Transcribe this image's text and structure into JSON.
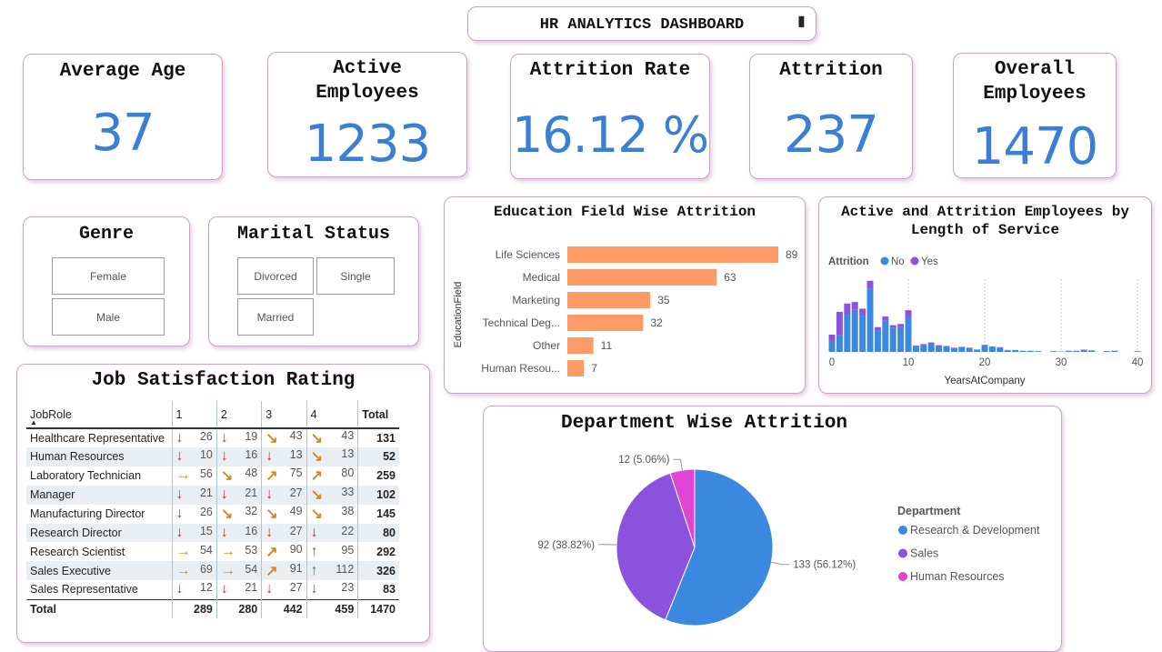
{
  "header": {
    "title": "HR ANALYTICS DASHBOARD",
    "marker": "▮"
  },
  "kpis": {
    "average_age": {
      "title": "Average Age",
      "value": "37"
    },
    "active_employees": {
      "title_line1": "Active",
      "title_line2": "Employees",
      "value": "1233"
    },
    "attrition_rate": {
      "title": "Attrition Rate",
      "value": "16.12 %"
    },
    "attrition": {
      "title": "Attrition",
      "value": "237"
    },
    "overall_employees": {
      "title_line1": "Overall",
      "title_line2": "Employees",
      "value": "1470"
    }
  },
  "slicers": {
    "genre": {
      "title": "Genre",
      "options": [
        "Female",
        "Male"
      ]
    },
    "marital": {
      "title": "Marital Status",
      "options": [
        "Divorced",
        "Single",
        "Married"
      ]
    }
  },
  "colors": {
    "accent_blue": "#3a7fd6",
    "bar_orange": "#fd9b67",
    "pie_blue": "#3a88e0",
    "pie_purple": "#8a52dd",
    "pie_magenta": "#e044d4",
    "arrow_red": "#c0392b",
    "arrow_orange": "#d08a21",
    "arrow_green": "#2e8b57"
  },
  "job_satisfaction": {
    "title": "Job Satisfaction Rating",
    "columns": [
      "JobRole",
      "1",
      "2",
      "3",
      "4",
      "Total"
    ],
    "rows": [
      {
        "role": "Healthcare Representative",
        "v": [
          26,
          19,
          43,
          43
        ],
        "a": [
          "down",
          "down",
          "downright",
          "downright"
        ],
        "total": 131
      },
      {
        "role": "Human Resources",
        "v": [
          10,
          16,
          13,
          13
        ],
        "a": [
          "down",
          "down",
          "down",
          "downright"
        ],
        "total": 52
      },
      {
        "role": "Laboratory Technician",
        "v": [
          56,
          48,
          75,
          80
        ],
        "a": [
          "right",
          "downright",
          "upright",
          "upright"
        ],
        "total": 259
      },
      {
        "role": "Manager",
        "v": [
          21,
          21,
          27,
          33
        ],
        "a": [
          "down",
          "down",
          "down",
          "downright"
        ],
        "total": 102
      },
      {
        "role": "Manufacturing Director",
        "v": [
          26,
          32,
          49,
          38
        ],
        "a": [
          "down",
          "downright",
          "downright",
          "downright"
        ],
        "total": 145
      },
      {
        "role": "Research Director",
        "v": [
          15,
          16,
          27,
          22
        ],
        "a": [
          "down",
          "down",
          "down",
          "down"
        ],
        "total": 80
      },
      {
        "role": "Research Scientist",
        "v": [
          54,
          53,
          90,
          95
        ],
        "a": [
          "right",
          "right",
          "upright",
          "up"
        ],
        "total": 292
      },
      {
        "role": "Sales Executive",
        "v": [
          69,
          54,
          91,
          112
        ],
        "a": [
          "right",
          "right",
          "upright",
          "up"
        ],
        "total": 326
      },
      {
        "role": "Sales Representative",
        "v": [
          12,
          21,
          27,
          23
        ],
        "a": [
          "down",
          "down",
          "down",
          "down"
        ],
        "total": 83
      }
    ],
    "total_row": {
      "label": "Total",
      "v": [
        289,
        280,
        442,
        459
      ],
      "total": 1470
    }
  },
  "chart_data": [
    {
      "type": "bar",
      "title": "Education Field Wise Attrition",
      "ylabel": "EducationField",
      "categories": [
        "Life Sciences",
        "Medical",
        "Marketing",
        "Technical Deg...",
        "Other",
        "Human Resou..."
      ],
      "values": [
        89,
        63,
        35,
        32,
        11,
        7
      ],
      "orientation": "horizontal"
    },
    {
      "type": "bar",
      "title": "Active and Attrition Employees by Length of Service",
      "xlabel": "YearsAtCompany",
      "legend_title": "Attrition",
      "stacked": true,
      "xticks": [
        "0",
        "10",
        "20",
        "30",
        "40"
      ],
      "x": [
        0,
        1,
        2,
        3,
        4,
        5,
        6,
        7,
        8,
        9,
        10,
        11,
        12,
        13,
        14,
        15,
        16,
        17,
        18,
        19,
        20,
        21,
        22,
        23,
        24,
        25,
        26,
        27,
        29,
        30,
        31,
        32,
        33,
        34,
        36,
        37,
        40
      ],
      "series": [
        {
          "name": "No",
          "values": [
            28,
            43,
            96,
            107,
            91,
            160,
            54,
            79,
            62,
            63,
            88,
            14,
            18,
            22,
            15,
            14,
            10,
            12,
            10,
            6,
            18,
            13,
            11,
            4,
            5,
            3,
            3,
            2,
            2,
            1,
            3,
            3,
            5,
            4,
            2,
            3,
            1
          ]
        },
        {
          "name": "Yes",
          "values": [
            16,
            59,
            27,
            20,
            19,
            21,
            9,
            11,
            6,
            8,
            18,
            2,
            2,
            2,
            2,
            1,
            1,
            1,
            1,
            0,
            0,
            1,
            1,
            1,
            0,
            0,
            0,
            0,
            0,
            0,
            0,
            0,
            1,
            0,
            0,
            0,
            1
          ]
        }
      ],
      "xlim": [
        0,
        40
      ]
    },
    {
      "type": "pie",
      "title": "Department Wise Attrition",
      "legend_title": "Department",
      "labels": [
        "Research & Development",
        "Sales",
        "Human Resources"
      ],
      "values": [
        133,
        92,
        12
      ],
      "data_labels": [
        "133 (56.12%)",
        "92 (38.82%)",
        "12 (5.06%)"
      ]
    }
  ]
}
